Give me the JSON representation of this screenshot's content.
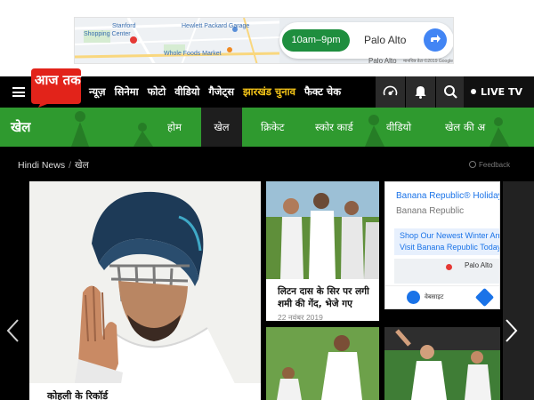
{
  "ad_top": {
    "map_labels": [
      "Stanford",
      "Shopping Center",
      "Hewlett Packard Garage",
      "Whole Foods Market",
      "Palo Alto"
    ],
    "hours": "10am–9pm",
    "city": "Palo Alto",
    "under_text": "Palo Alto",
    "credit": "मानचित्र डेटा ©2019 Google"
  },
  "header": {
    "logo_text": "आज तक",
    "nav": [
      "न्यूज़",
      "सिनेमा",
      "फोटो",
      "वीडियो",
      "गैजेट्स",
      "झारखंड चुनाव",
      "फैक्ट चेक"
    ],
    "highlight_index": 5,
    "live_label": "LIVE TV",
    "icons": [
      "podcast-icon",
      "bell-icon",
      "search-icon"
    ]
  },
  "section": {
    "title": "खेल",
    "tabs": [
      "होम",
      "खेल",
      "क्रिकेट",
      "स्कोर कार्ड",
      "वीडियो",
      "खेल की अ"
    ],
    "active_tab": "खेल"
  },
  "breadcrumb": {
    "home": "Hindi News",
    "sep": "/",
    "current": "खेल"
  },
  "feedback": "Feedback",
  "hero": {
    "caption": "कोहली के रिकॉर्ड"
  },
  "cards": [
    {
      "title": "लिटन दास के सिर पर लगी शमी की गेंद, भेजे गए",
      "date": "22 नवंबर 2019"
    }
  ],
  "banner_ad": {
    "title": "Banana Republic® Holiday",
    "subtitle": "Banana Republic",
    "promo_line1": "Shop Our Newest Winter Arri",
    "promo_line2": "Visit Banana Republic Today",
    "city": "Palo Alto",
    "website": "वेबसाइट"
  },
  "colors": {
    "brand_red": "#e2231a",
    "section_green": "#2f9a2f",
    "highlight": "#f5c518",
    "ad_green": "#1e8e3e",
    "ad_blue": "#4285f4"
  }
}
